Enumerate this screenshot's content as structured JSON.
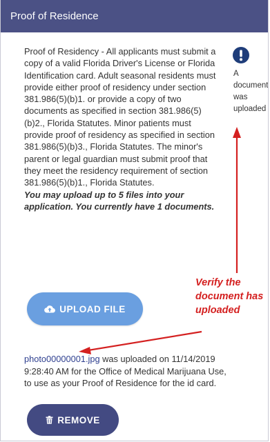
{
  "panel": {
    "title": "Proof of Residence"
  },
  "description": {
    "text": "Proof of Residency - All applicants must submit a copy of a valid Florida Driver's License or Florida Identification card. Adult seasonal residents must provide either proof of residency under section 381.986(5)(b)1. or provide a copy of two documents as specified in section 381.986(5)(b)2., Florida Statutes. Minor patients must provide proof of residency as specified in section 381.986(5)(b)3., Florida Statutes. The minor's parent or legal guardian must submit proof that they meet the residency requirement of section 381.986(5)(b)1., Florida Statutes.",
    "upload_limit": "You may upload up to 5 files into your application. You currently have 1 documents."
  },
  "status": {
    "icon": "exclamation-circle-icon",
    "message": "A\ndocument\nwas\nuploaded"
  },
  "buttons": {
    "upload_label": "UPLOAD FILE",
    "upload_icon": "cloud-upload-icon",
    "remove_label": "REMOVE",
    "remove_icon": "trash-icon"
  },
  "upload": {
    "filename": "photo00000001.jpg",
    "message": " was uploaded on 11/14/2019 9:28:40 AM for the Office of Medical Marijuana Use, to use as your Proof of Residence for the id card."
  },
  "annotation": {
    "text": "Verify the\ndocument has\nuploaded",
    "color": "#d42020"
  },
  "colors": {
    "header": "#4b5185",
    "upload_button": "#6a9fe0",
    "remove_button": "#434a82",
    "filename_link": "#2e3f8f"
  }
}
